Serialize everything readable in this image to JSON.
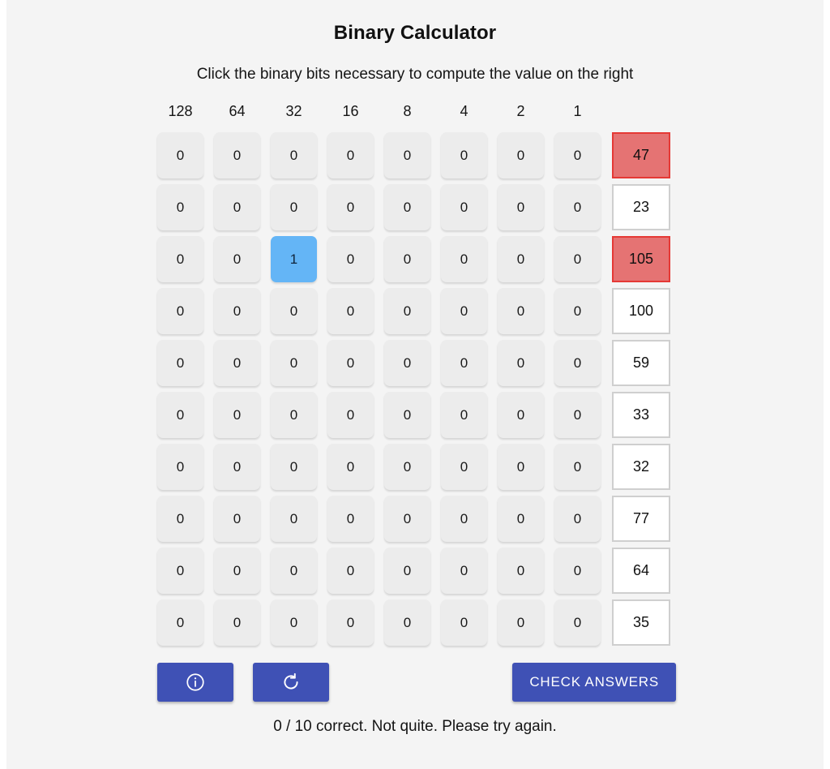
{
  "app": {
    "title": "Binary Calculator",
    "instructions": "Click the binary bits necessary to compute the value on the right",
    "status": "0 / 10 correct. Not quite. Please try again."
  },
  "grid": {
    "bit_headers": [
      "128",
      "64",
      "32",
      "16",
      "8",
      "4",
      "2",
      "1"
    ],
    "rows": [
      {
        "bits": [
          "0",
          "0",
          "0",
          "0",
          "0",
          "0",
          "0",
          "0"
        ],
        "target": "47",
        "state": "wrong"
      },
      {
        "bits": [
          "0",
          "0",
          "0",
          "0",
          "0",
          "0",
          "0",
          "0"
        ],
        "target": "23",
        "state": "neutral"
      },
      {
        "bits": [
          "0",
          "0",
          "1",
          "0",
          "0",
          "0",
          "0",
          "0"
        ],
        "target": "105",
        "state": "wrong"
      },
      {
        "bits": [
          "0",
          "0",
          "0",
          "0",
          "0",
          "0",
          "0",
          "0"
        ],
        "target": "100",
        "state": "neutral"
      },
      {
        "bits": [
          "0",
          "0",
          "0",
          "0",
          "0",
          "0",
          "0",
          "0"
        ],
        "target": "59",
        "state": "neutral"
      },
      {
        "bits": [
          "0",
          "0",
          "0",
          "0",
          "0",
          "0",
          "0",
          "0"
        ],
        "target": "33",
        "state": "neutral"
      },
      {
        "bits": [
          "0",
          "0",
          "0",
          "0",
          "0",
          "0",
          "0",
          "0"
        ],
        "target": "32",
        "state": "neutral"
      },
      {
        "bits": [
          "0",
          "0",
          "0",
          "0",
          "0",
          "0",
          "0",
          "0"
        ],
        "target": "77",
        "state": "neutral"
      },
      {
        "bits": [
          "0",
          "0",
          "0",
          "0",
          "0",
          "0",
          "0",
          "0"
        ],
        "target": "64",
        "state": "neutral"
      },
      {
        "bits": [
          "0",
          "0",
          "0",
          "0",
          "0",
          "0",
          "0",
          "0"
        ],
        "target": "35",
        "state": "neutral"
      }
    ]
  },
  "toolbar": {
    "info_icon": "info-circle-icon",
    "reset_icon": "refresh-icon",
    "check_label": "CHECK ANSWERS"
  },
  "colors": {
    "page_background": "#f4f4f4",
    "bit_off": "#ececec",
    "bit_on": "#64b5f6",
    "target_wrong_fill": "#e57373",
    "target_wrong_border": "#e53935",
    "target_border": "#cfcfcf",
    "button": "#3f51b5"
  }
}
